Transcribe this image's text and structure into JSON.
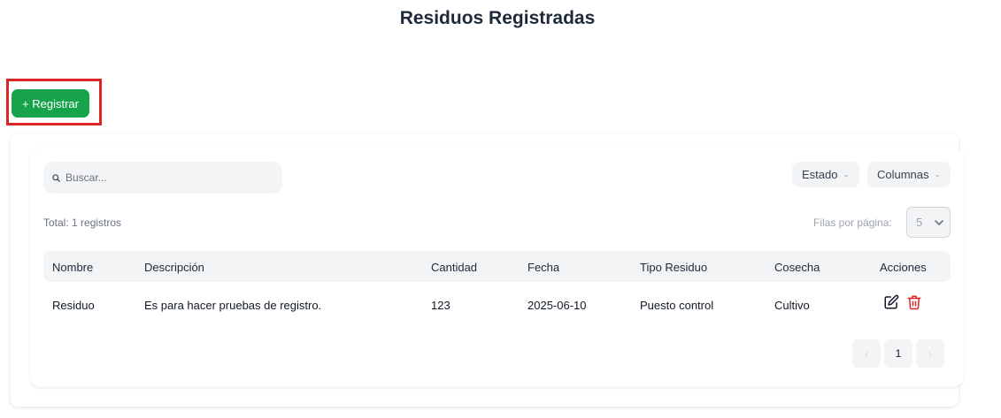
{
  "page": {
    "title": "Residuos Registradas"
  },
  "actions": {
    "register_label": "+ Registrar"
  },
  "search": {
    "placeholder": "Buscar...",
    "value": ""
  },
  "filters": {
    "estado_label": "Estado",
    "columnas_label": "Columnas",
    "chevron": "⌄"
  },
  "summary": {
    "total": "Total: 1 registros"
  },
  "pagination": {
    "rows_label": "Filas por página:",
    "rows_value": "5",
    "current_page": "1",
    "prev_symbol": "‹",
    "next_symbol": "›"
  },
  "table": {
    "headers": [
      "Nombre",
      "Descripción",
      "Cantidad",
      "Fecha",
      "Tipo Residuo",
      "Cosecha",
      "Acciones"
    ],
    "rows": [
      [
        "Residuo",
        "Es para hacer pruebas de registro.",
        "123",
        "2025-06-10",
        "Puesto control",
        "Cultivo"
      ]
    ]
  },
  "colors": {
    "accent_green": "#16a34a",
    "highlight_red": "#dc2626",
    "delete_red": "#dc2626"
  },
  "icons": {
    "search": "search-icon",
    "edit": "edit-icon",
    "delete": "trash-icon",
    "chevron": "chevron-down-icon"
  }
}
